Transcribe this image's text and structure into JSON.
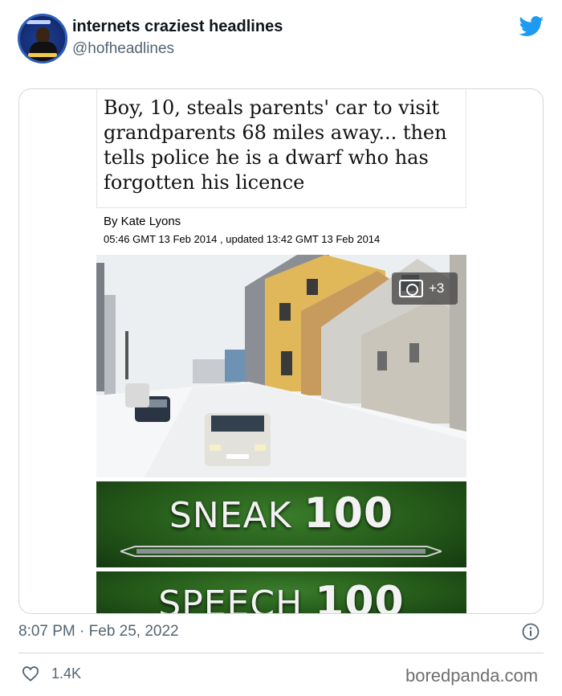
{
  "author": {
    "name": "internets craziest headlines",
    "handle": "@hofheadlines",
    "avatar_icon": "profile-photo"
  },
  "platform_icon": "twitter-bird-icon",
  "colors": {
    "twitter_blue": "#1d9bf0",
    "muted_text": "#536471",
    "border": "#cfd9de",
    "banner_green": "#2f6a22"
  },
  "article": {
    "headline": "Boy, 10, steals parents' car to visit grandparents 68 miles away... then tells police he is a dwarf who has forgotten his licence",
    "byline": "By Kate Lyons",
    "dateline": "05:46 GMT 13 Feb 2014 , updated 13:42 GMT 13 Feb 2014",
    "photo_count": "+3",
    "photo_icon": "camera-icon"
  },
  "banners": [
    {
      "skill": "SNEAK",
      "level": "100"
    },
    {
      "skill": "SPEECH",
      "level": "100"
    }
  ],
  "tweet": {
    "timestamp": "8:07 PM · Feb 25, 2022",
    "likes": "1.4K"
  },
  "watermark": "boredpanda.com"
}
